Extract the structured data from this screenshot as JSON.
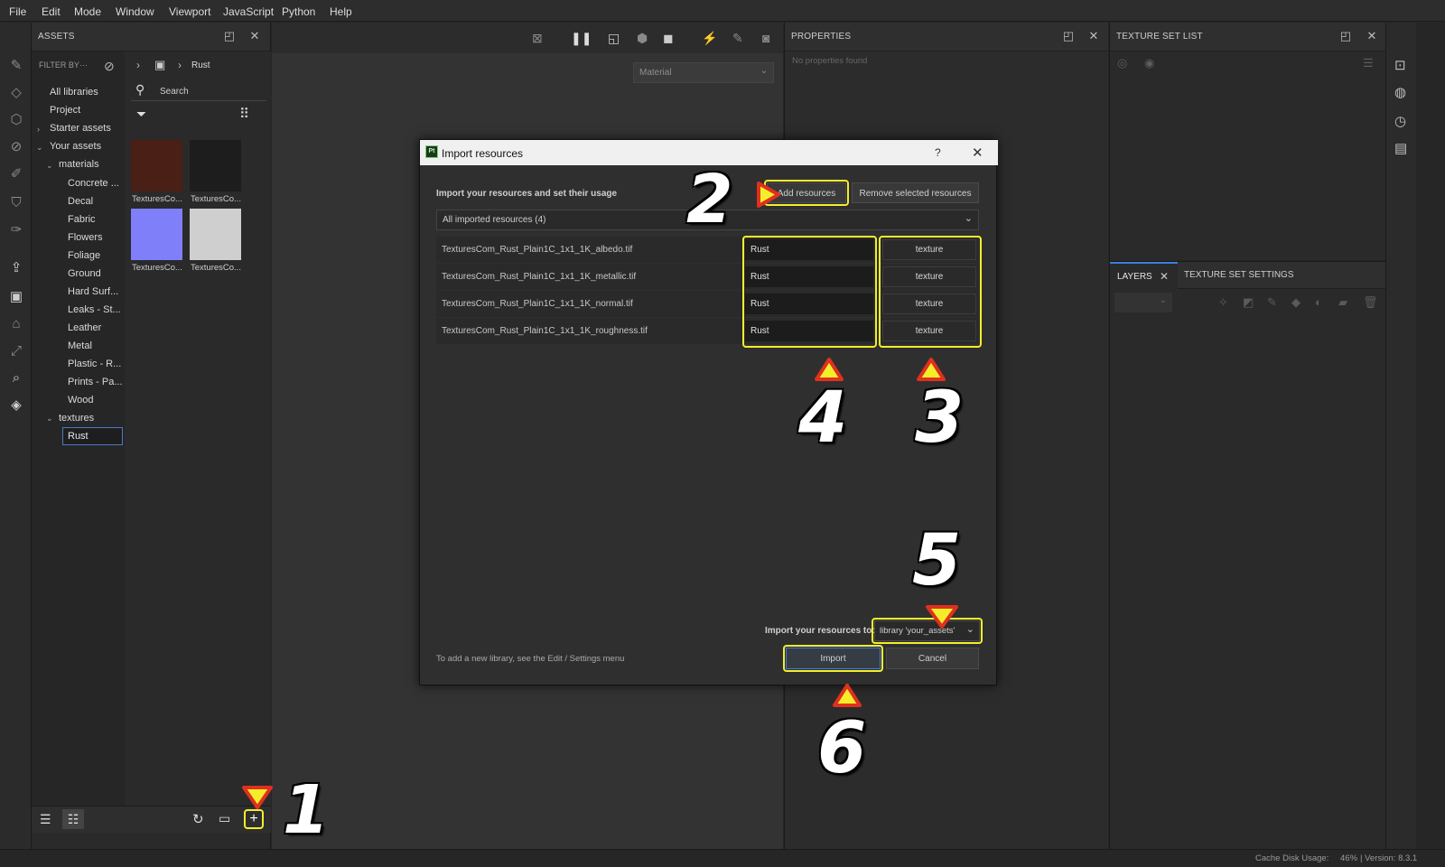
{
  "menu": [
    "File",
    "Edit",
    "Mode",
    "Window",
    "Viewport",
    "JavaScript",
    "Python",
    "Help"
  ],
  "assets_panel": {
    "title": "ASSETS",
    "filter_label": "FILTER BY···",
    "breadcrumb_current": "Rust",
    "search_placeholder": "Search",
    "tree": {
      "all_libraries": "All libraries",
      "project": "Project",
      "starter_assets": "Starter assets",
      "your_assets": "Your assets",
      "materials": "materials",
      "material_items": [
        "Concrete ...",
        "Decal",
        "Fabric",
        "Flowers",
        "Foliage",
        "Ground",
        "Hard Surf...",
        "Leaks - St...",
        "Leather",
        "Metal",
        "Plastic - R...",
        "Prints - Pa...",
        "Wood"
      ],
      "textures": "textures",
      "rust_value": "Rust"
    },
    "thumbs": [
      {
        "label": "TexturesCo...",
        "color": "#4a1f16"
      },
      {
        "label": "TexturesCo...",
        "color": "#1d1d1d"
      },
      {
        "label": "TexturesCo...",
        "color": "#7f7ffa"
      },
      {
        "label": "TexturesCo...",
        "color": "#cfcfcf"
      }
    ]
  },
  "viewport": {
    "material_select": "Material"
  },
  "properties": {
    "title": "PROPERTIES",
    "empty": "No properties found"
  },
  "texture_set_list": {
    "title": "TEXTURE SET LIST"
  },
  "layers": {
    "tab_layers": "LAYERS",
    "tab_settings": "TEXTURE SET SETTINGS"
  },
  "status": {
    "cache": "Cache Disk Usage:",
    "cache_value": "46%",
    "version": "| Version: 8.3.1"
  },
  "dialog": {
    "title": "Import resources",
    "help": "?",
    "intro": "Import your resources and set their usage",
    "add_button": "Add resources",
    "remove_button": "Remove selected resources",
    "filter_select": "All imported resources (4)",
    "rows": [
      {
        "file": "TexturesCom_Rust_Plain1C_1x1_1K_albedo.tif",
        "usage": "Rust",
        "type": "texture"
      },
      {
        "file": "TexturesCom_Rust_Plain1C_1x1_1K_metallic.tif",
        "usage": "Rust",
        "type": "texture"
      },
      {
        "file": "TexturesCom_Rust_Plain1C_1x1_1K_normal.tif",
        "usage": "Rust",
        "type": "texture"
      },
      {
        "file": "TexturesCom_Rust_Plain1C_1x1_1K_roughness.tif",
        "usage": "Rust",
        "type": "texture"
      }
    ],
    "import_to_label": "Import your resources to:",
    "import_to_value": "library 'your_assets'",
    "footer_note": "To add a new library, see the Edit / Settings menu",
    "import_button": "Import",
    "cancel_button": "Cancel"
  },
  "annotations": {
    "step1": "1",
    "step2": "2",
    "step3": "3",
    "step4": "4",
    "step5": "5",
    "step6": "6",
    "highlight_color": "#f4ee2a",
    "arrow_fill": "#f4ee2a",
    "arrow_stroke": "#e0301e"
  }
}
